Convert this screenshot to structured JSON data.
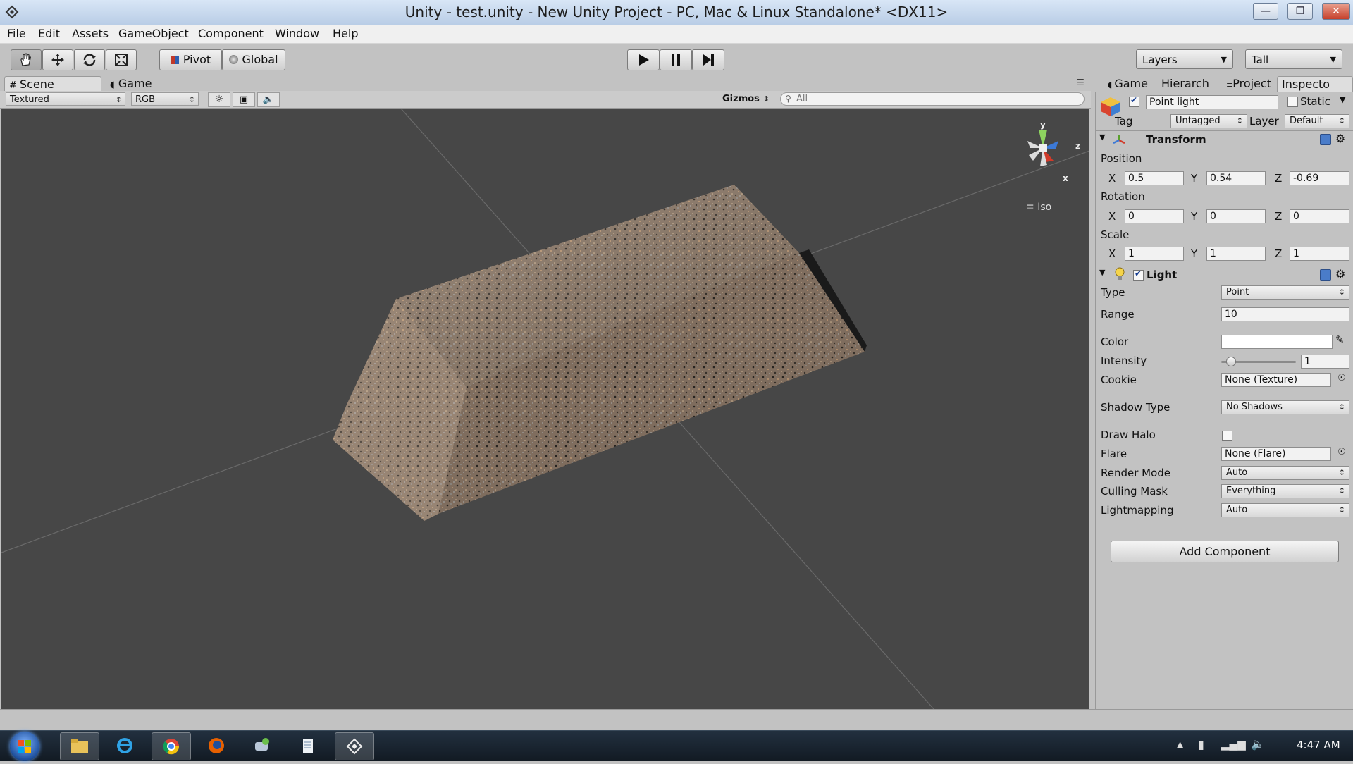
{
  "window": {
    "title": "Unity - test.unity - New Unity Project - PC, Mac & Linux Standalone* <DX11>",
    "controls": [
      "—",
      "❐",
      "✕"
    ]
  },
  "menu": [
    "File",
    "Edit",
    "Assets",
    "GameObject",
    "Component",
    "Window",
    "Help"
  ],
  "toolbar": {
    "tools": [
      "hand-icon",
      "move-icon",
      "rotate-icon",
      "scale-icon"
    ],
    "pivot_label": "Pivot",
    "global_label": "Global",
    "playback": [
      "play-icon",
      "pause-icon",
      "step-icon"
    ],
    "layers_label": "Layers",
    "layout_label": "Tall"
  },
  "scene": {
    "tab_scene": "Scene",
    "tab_game": "Game",
    "render_mode": "Textured",
    "color_mode": "RGB",
    "gizmos_label": "Gizmos",
    "search_placeholder": "All",
    "gizmo_axes": {
      "y": "y",
      "z": "z",
      "x": "x"
    },
    "projection": "Iso"
  },
  "inspector": {
    "tabs": [
      "Game",
      "Hierarch",
      "Project",
      "Inspecto"
    ],
    "object_name": "Point light",
    "object_enabled": true,
    "static_label": "Static",
    "static_checked": false,
    "tag_label": "Tag",
    "tag_value": "Untagged",
    "layer_label": "Layer",
    "layer_value": "Default",
    "transform": {
      "title": "Transform",
      "position_label": "Position",
      "position": {
        "x": "0.5",
        "y": "0.54",
        "z": "-0.69"
      },
      "rotation_label": "Rotation",
      "rotation": {
        "x": "0",
        "y": "0",
        "z": "0"
      },
      "scale_label": "Scale",
      "scale": {
        "x": "1",
        "y": "1",
        "z": "1"
      },
      "axis_x": "X",
      "axis_y": "Y",
      "axis_z": "Z"
    },
    "light": {
      "title": "Light",
      "enabled": true,
      "type_label": "Type",
      "type_value": "Point",
      "range_label": "Range",
      "range_value": "10",
      "color_label": "Color",
      "color_value": "#ffffff",
      "intensity_label": "Intensity",
      "intensity_value": "1",
      "intensity_fraction": 0.125,
      "cookie_label": "Cookie",
      "cookie_value": "None (Texture)",
      "shadow_type_label": "Shadow Type",
      "shadow_type_value": "No Shadows",
      "draw_halo_label": "Draw Halo",
      "draw_halo_checked": false,
      "flare_label": "Flare",
      "flare_value": "None (Flare)",
      "render_mode_label": "Render Mode",
      "render_mode_value": "Auto",
      "culling_mask_label": "Culling Mask",
      "culling_mask_value": "Everything",
      "lightmapping_label": "Lightmapping",
      "lightmapping_value": "Auto"
    },
    "add_component_label": "Add Component"
  },
  "taskbar": {
    "apps": [
      "file-explorer-icon",
      "internet-explorer-icon",
      "chrome-icon",
      "firefox-icon",
      "app-icon",
      "document-icon",
      "unity-icon"
    ],
    "time": "4:47 AM"
  }
}
